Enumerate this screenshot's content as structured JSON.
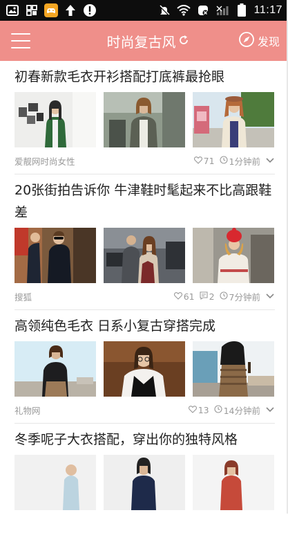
{
  "status_bar": {
    "time": "11:17",
    "left_icons": [
      "image-icon",
      "grid-icon",
      "game-controller-icon",
      "upload-arrow-icon",
      "alert-icon"
    ],
    "right_icons": [
      "mute-icon",
      "wifi-icon",
      "no-data-icon",
      "signal-icon",
      "battery-icon"
    ]
  },
  "app_bar": {
    "title": "时尚复古风",
    "discover_label": "发现",
    "accent_color": "#ef8f8a"
  },
  "articles": [
    {
      "title": "初春新款毛衣开衫搭配打底裤最抢眼",
      "source": "爱靓网时尚女性",
      "likes": "71",
      "time": "1分钟前"
    },
    {
      "title": "20张街拍告诉你 牛津鞋时髦起来不比高跟鞋差",
      "source": "搜狐",
      "likes": "61",
      "comments": "2",
      "time": "7分钟前"
    },
    {
      "title": "高领纯色毛衣 日系小复古穿搭完成",
      "source": "礼物网",
      "likes": "13",
      "time": "14分钟前"
    },
    {
      "title": "冬季呢子大衣搭配，穿出你的独特风格"
    }
  ]
}
